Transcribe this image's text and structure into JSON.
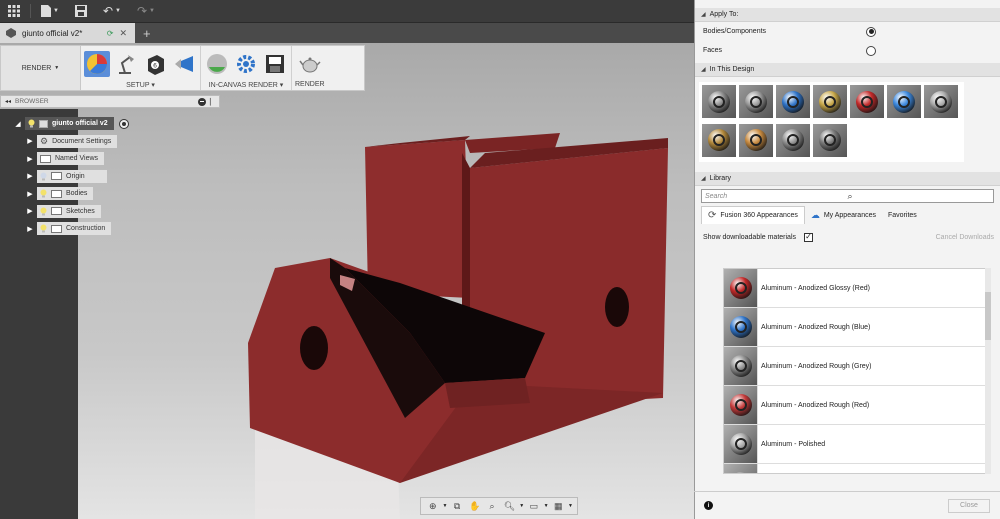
{
  "document": {
    "tab_title": "giunto official v2*"
  },
  "ribbon": {
    "mode": "RENDER",
    "groups": [
      {
        "label": "SETUP"
      },
      {
        "label": "IN-CANVAS RENDER"
      },
      {
        "label": "RENDER"
      }
    ]
  },
  "browser": {
    "title": "BROWSER",
    "root": "giunto official v2",
    "items": [
      {
        "label": "Document Settings",
        "icon": "gear-icon"
      },
      {
        "label": "Named Views",
        "icon": "folder-icon"
      },
      {
        "label": "Origin",
        "icon": "folder-icon"
      },
      {
        "label": "Bodies",
        "icon": "folder-icon"
      },
      {
        "label": "Sketches",
        "icon": "folder-icon"
      },
      {
        "label": "Construction",
        "icon": "folder-icon"
      }
    ]
  },
  "panel": {
    "apply_to": {
      "title": "Apply To:",
      "options": [
        {
          "label": "Bodies/Components",
          "selected": true
        },
        {
          "label": "Faces",
          "selected": false
        }
      ]
    },
    "in_this_design": {
      "title": "In This Design",
      "swatches": [
        "#8c8c8c",
        "#9a9a9a",
        "#2f74c9",
        "#c9a94a",
        "#c42a2a",
        "#3d8ae0",
        "#aaaaaa",
        "#b48a3c",
        "#c98b40",
        "#8f8f8f",
        "#7c7c7c"
      ]
    },
    "library": {
      "title": "Library",
      "search_placeholder": "Search",
      "tabs": [
        "Fusion 360 Appearances",
        "My Appearances",
        "Favorites"
      ],
      "show_downloadable": "Show downloadable materials",
      "cancel_downloads": "Cancel Downloads",
      "items": [
        {
          "name": "Aluminum - Anodized Glossy (Red)",
          "color": "#c42a2a"
        },
        {
          "name": "Aluminum - Anodized Rough (Blue)",
          "color": "#2f74c9"
        },
        {
          "name": "Aluminum - Anodized Rough (Grey)",
          "color": "#8c8c8c"
        },
        {
          "name": "Aluminum - Anodized Rough (Red)",
          "color": "#c43a3a"
        },
        {
          "name": "Aluminum - Polished",
          "color": "#a5a5a5"
        },
        {
          "name": "",
          "color": "#9a9a9a"
        }
      ]
    },
    "close_label": "Close"
  },
  "colors": {
    "model": "#8a2b2b",
    "accent": "#5b8ed9"
  }
}
